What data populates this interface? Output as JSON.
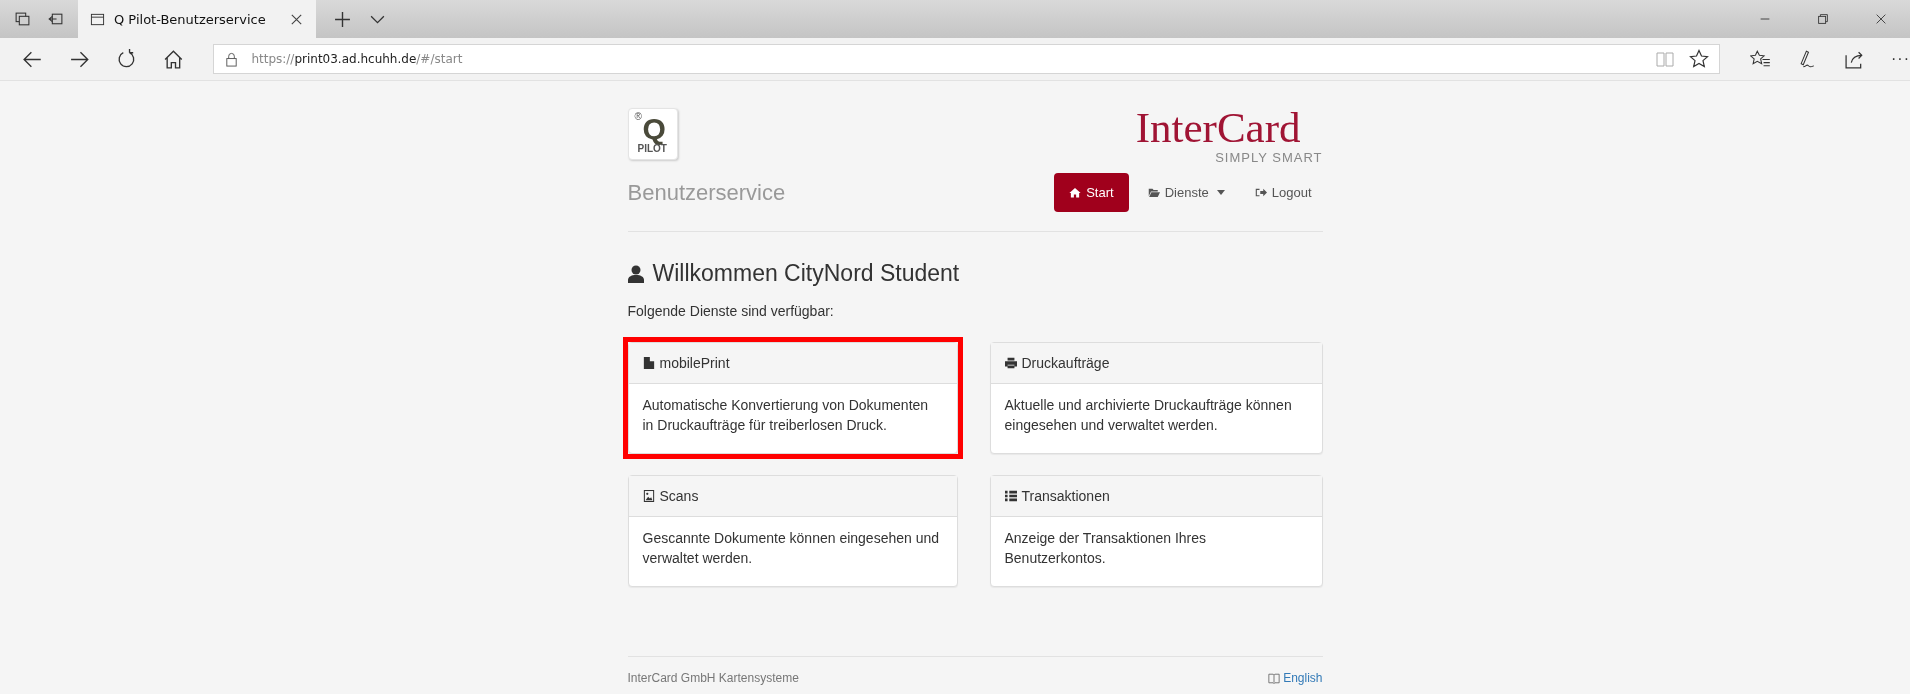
{
  "browser": {
    "tab_title": "Q Pilot-Benutzerservice",
    "url": {
      "scheme": "https://",
      "host": "print03.ad.hcuhh.de",
      "path": "/#/start"
    },
    "more": "···"
  },
  "header": {
    "logo_mark": "®",
    "logo_letter": "Q",
    "logo_text": "PILOT",
    "brand": "InterCard",
    "tagline": "SIMPLY SMART",
    "title": "Benutzerservice"
  },
  "nav": [
    {
      "label": "Start",
      "selected": true,
      "dropdown": false
    },
    {
      "label": "Dienste",
      "selected": false,
      "dropdown": true
    },
    {
      "label": "Logout",
      "selected": false,
      "dropdown": false
    }
  ],
  "welcome": "Willkommen CityNord Student",
  "intro": "Folgende Dienste sind verfügbar:",
  "services": [
    {
      "title": "mobilePrint",
      "text": "Automatische Konvertierung von Dokumenten in Druckaufträge für treiberlosen Druck.",
      "highlighted": true
    },
    {
      "title": "Druckaufträge",
      "text": "Aktuelle und archivierte Druckaufträge können eingesehen und verwaltet werden.",
      "highlighted": false
    },
    {
      "title": "Scans",
      "text": "Gescannte Dokumente können eingesehen und verwaltet werden.",
      "highlighted": false
    },
    {
      "title": "Transaktionen",
      "text": "Anzeige der Transaktionen Ihres Benutzerkontos.",
      "highlighted": false
    }
  ],
  "footer": {
    "company": "InterCard GmbH Kartensysteme",
    "language": "English"
  }
}
